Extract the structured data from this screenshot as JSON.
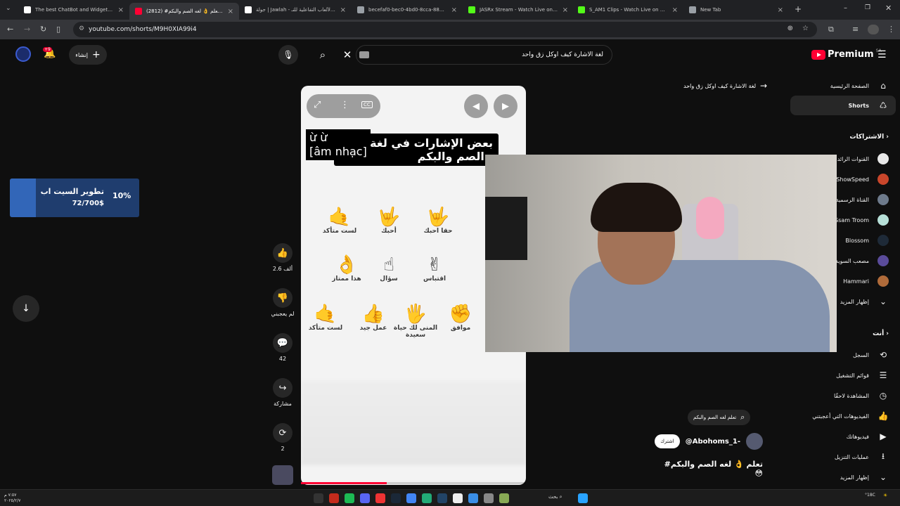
{
  "tabs": [
    {
      "title": "The best ChatBot and Widgets for Kick, Tw",
      "color": "#ffffff"
    },
    {
      "title": "(2812) #تعلم 👌 لغه الصم والبكم 😳",
      "color": "#ff0033",
      "active": true
    },
    {
      "title": "جولة | Jawlah - منصة الألعاب التفاعلية للنـ",
      "color": "#ffffff"
    },
    {
      "title": "becefaf0-bec0-4bd0-8cca-8808b1b539...",
      "color": "#9aa0a6"
    },
    {
      "title": "JASRx Stream - Watch Live on Kick",
      "color": "#53fc18"
    },
    {
      "title": "S_AM1 Clips - Watch Live on Kick",
      "color": "#53fc18"
    },
    {
      "title": "New Tab",
      "color": "#9aa0a6"
    }
  ],
  "address": {
    "url": "youtube.com/shorts/M9H0XIA99i4"
  },
  "header": {
    "search_query": "لغة الاشارة كيف اوكل زق واحد",
    "create_label": "إنشاء",
    "notif_count": "+9",
    "logo_word": "Premium",
    "logo_region": "SA"
  },
  "related": {
    "label": "لغة الاشارة كيف اوكل زق واحد"
  },
  "sidebar": {
    "home": "الصفحة الرئيسية",
    "shorts": "Shorts",
    "subs_header": "الاشتراكات",
    "channels": [
      {
        "label": "القنوات الرائدة",
        "color": "#e8e8e8"
      },
      {
        "label": "IShowSpeed",
        "color": "#c9462b"
      },
      {
        "label": "القناة الرسمية",
        "color": "#6e7b8c"
      },
      {
        "label": "Ssam Troom",
        "color": "#b7e0d8"
      },
      {
        "label": "Blossom",
        "color": "#1e2a38"
      },
      {
        "label": "مصعب السويد",
        "color": "#5a4b9a"
      },
      {
        "label": "Hammari",
        "color": "#b06b3a"
      }
    ],
    "show_more": "إظهار المزيد",
    "you_header": "أنت",
    "you_items": [
      "السجل",
      "قوائم التشغيل",
      "المشاهدة لاحقًا",
      "الفيديوهات التي أعجبتني",
      "فيديوهاتك",
      "عمليات التنزيل",
      "إظهار المزيد"
    ]
  },
  "player": {
    "caption": "ừ ừ\n[âm nhạc]",
    "title_text": "بعض الإشارات في لغة الصم والبكم..",
    "cc": "CC",
    "progress": 0.38,
    "signs": [
      {
        "label": "لست متأكد",
        "hand": "🤙"
      },
      {
        "label": "أحبك",
        "hand": "🤟"
      },
      {
        "label": "حقا احبك",
        "hand": "🤟"
      },
      {
        "label": "هذا ممتاز",
        "hand": "👌"
      },
      {
        "label": "سؤال",
        "hand": "☝"
      },
      {
        "label": "اقتباس",
        "hand": "✌"
      },
      {
        "label": "لست متأكد",
        "hand": "🤙"
      },
      {
        "label": "عمل جيد",
        "hand": "👍"
      },
      {
        "label": "المنى لك حياة سعيدة",
        "hand": "🖐"
      },
      {
        "label": "موافق",
        "hand": "✊"
      }
    ]
  },
  "actions": {
    "like_count": "2.6 ألف",
    "dislike_label": "لم يعجبني",
    "comment_count": "42",
    "share_label": "مشاركة",
    "remix_count": "2"
  },
  "donation": {
    "label": "تطوير السيت اب",
    "amount": "72/700$",
    "percent_text": "10%",
    "fraction": 0.1
  },
  "short_info": {
    "suggest": "تعلم لغه الصم والبكم",
    "channel": "@Abohoms_1-",
    "subscribe": "اشترك",
    "title": "#تعلم 👌 لغه الصم والبكم 😳"
  },
  "taskbar": {
    "search": "بحث",
    "time": "٧:٥٧ م",
    "date": "٢٠٢٥/٢/٧",
    "weather": "°18C"
  }
}
